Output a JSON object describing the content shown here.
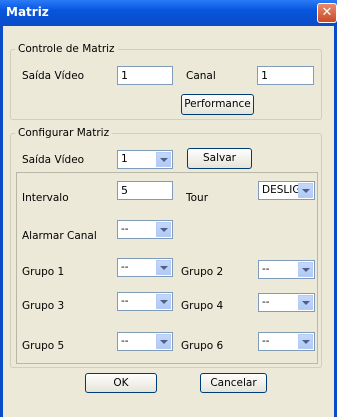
{
  "window": {
    "title": "Matriz",
    "close_symbol": "✕"
  },
  "controle": {
    "legend": "Controle de Matriz",
    "saida_label": "Saída Vídeo",
    "saida_value": "1",
    "canal_label": "Canal",
    "canal_value": "1",
    "performance_label": "Performance"
  },
  "configurar": {
    "legend": "Configurar Matriz",
    "saida_label": "Saída Vídeo",
    "saida_value": "1",
    "salvar_label": "Salvar",
    "intervalo_label": "Intervalo",
    "intervalo_value": "5",
    "tour_label": "Tour",
    "tour_value": "DESLIG",
    "alarmar_label": "Alarmar Canal",
    "alarmar_value": "--",
    "grupos": [
      {
        "label": "Grupo 1",
        "value": "--"
      },
      {
        "label": "Grupo 2",
        "value": "--"
      },
      {
        "label": "Grupo 3",
        "value": "--"
      },
      {
        "label": "Grupo 4",
        "value": "--"
      },
      {
        "label": "Grupo 5",
        "value": "--"
      },
      {
        "label": "Grupo 6",
        "value": "--"
      }
    ]
  },
  "footer": {
    "ok_label": "OK",
    "cancel_label": "Cancelar"
  },
  "colors": {
    "titlebar": "#0a4bc7",
    "dialog_bg": "#ece9d8",
    "close_button": "#c94a26"
  }
}
